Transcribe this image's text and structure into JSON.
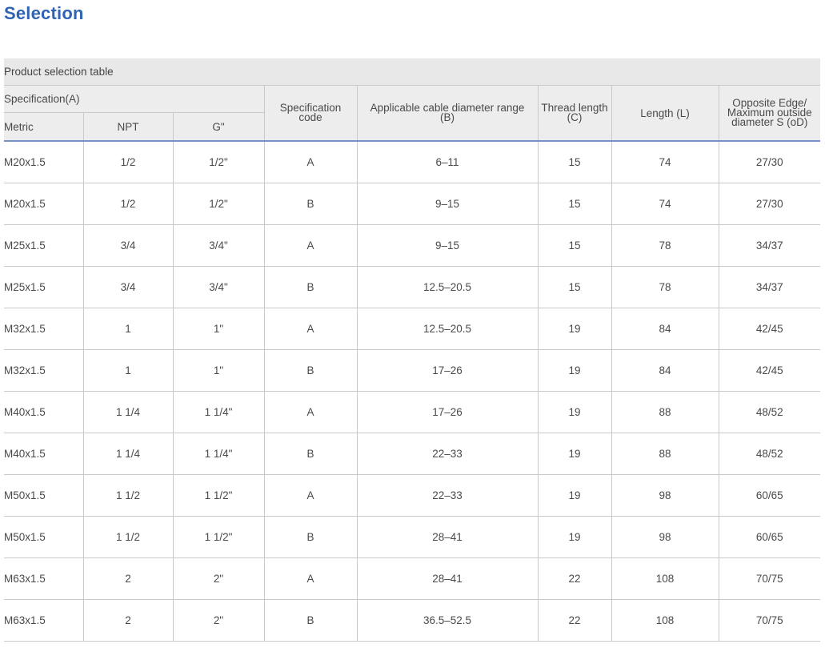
{
  "page_title": "Selection",
  "table": {
    "caption": "Product selection table",
    "group_header": "Specification(A)",
    "sub_headers": [
      "Metric",
      "NPT",
      "G\""
    ],
    "spec_code_line1": "Specification",
    "spec_code_line2": "code",
    "cable_line1": "Applicable cable diameter range",
    "cable_line2": "(B)",
    "thread_line1": "Thread length",
    "thread_line2": "(C)",
    "length_header": "Length  (L)",
    "edge_line1": "Opposite Edge/",
    "edge_line2": "Maximum outside",
    "edge_line3": "diameter S (oD)",
    "rows": [
      [
        "M20x1.5",
        "1/2",
        "1/2\"",
        "A",
        "6–11",
        "15",
        "74",
        "27/30"
      ],
      [
        "M20x1.5",
        "1/2",
        "1/2\"",
        "B",
        "9–15",
        "15",
        "74",
        "27/30"
      ],
      [
        "M25x1.5",
        "3/4",
        "3/4\"",
        "A",
        "9–15",
        "15",
        "78",
        "34/37"
      ],
      [
        "M25x1.5",
        "3/4",
        "3/4\"",
        "B",
        "12.5–20.5",
        "15",
        "78",
        "34/37"
      ],
      [
        "M32x1.5",
        "1",
        "1\"",
        "A",
        "12.5–20.5",
        "19",
        "84",
        "42/45"
      ],
      [
        "M32x1.5",
        "1",
        "1\"",
        "B",
        "17–26",
        "19",
        "84",
        "42/45"
      ],
      [
        "M40x1.5",
        "1 1/4",
        "1 1/4\"",
        "A",
        "17–26",
        "19",
        "88",
        "48/52"
      ],
      [
        "M40x1.5",
        "1 1/4",
        "1 1/4\"",
        "B",
        "22–33",
        "19",
        "88",
        "48/52"
      ],
      [
        "M50x1.5",
        "1 1/2",
        "1 1/2\"",
        "A",
        "22–33",
        "19",
        "98",
        "60/65"
      ],
      [
        "M50x1.5",
        "1 1/2",
        "1 1/2\"",
        "B",
        "28–41",
        "19",
        "98",
        "60/65"
      ],
      [
        "M63x1.5",
        "2",
        "2\"",
        "A",
        "28–41",
        "22",
        "108",
        "70/75"
      ],
      [
        "M63x1.5",
        "2",
        "2\"",
        "B",
        "36.5–52.5",
        "22",
        "108",
        "70/75"
      ]
    ]
  }
}
